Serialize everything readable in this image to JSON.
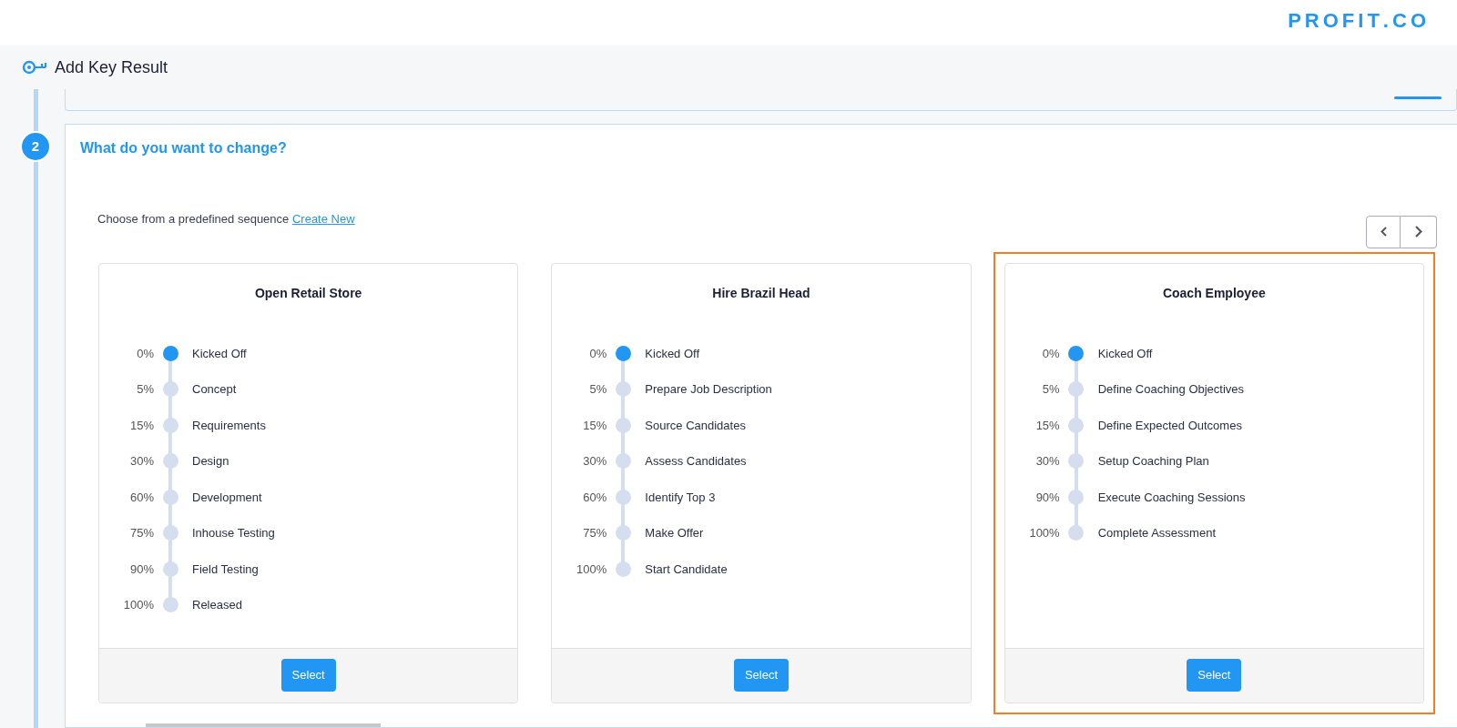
{
  "brand": {
    "logo": "PROFIT.CO"
  },
  "page": {
    "title": "Add Key Result"
  },
  "step": {
    "number": "2",
    "title": "What do you want to change?"
  },
  "intro": {
    "text": "Choose from a predefined sequence",
    "link": "Create New"
  },
  "cards": [
    {
      "title": "Open Retail Store",
      "highlighted": false,
      "button": "Select",
      "steps": [
        {
          "percent": "0%",
          "label": "Kicked Off",
          "active": true
        },
        {
          "percent": "5%",
          "label": "Concept",
          "active": false
        },
        {
          "percent": "15%",
          "label": "Requirements",
          "active": false
        },
        {
          "percent": "30%",
          "label": "Design",
          "active": false
        },
        {
          "percent": "60%",
          "label": "Development",
          "active": false
        },
        {
          "percent": "75%",
          "label": "Inhouse Testing",
          "active": false
        },
        {
          "percent": "90%",
          "label": "Field Testing",
          "active": false
        },
        {
          "percent": "100%",
          "label": "Released",
          "active": false
        }
      ]
    },
    {
      "title": "Hire Brazil Head",
      "highlighted": false,
      "button": "Select",
      "steps": [
        {
          "percent": "0%",
          "label": "Kicked Off",
          "active": true
        },
        {
          "percent": "5%",
          "label": "Prepare Job Description",
          "active": false
        },
        {
          "percent": "15%",
          "label": "Source Candidates",
          "active": false
        },
        {
          "percent": "30%",
          "label": "Assess Candidates",
          "active": false
        },
        {
          "percent": "60%",
          "label": "Identify Top 3",
          "active": false
        },
        {
          "percent": "75%",
          "label": "Make Offer",
          "active": false
        },
        {
          "percent": "100%",
          "label": "Start Candidate",
          "active": false
        }
      ]
    },
    {
      "title": "Coach Employee",
      "highlighted": true,
      "button": "Select",
      "steps": [
        {
          "percent": "0%",
          "label": "Kicked Off",
          "active": true
        },
        {
          "percent": "5%",
          "label": "Define Coaching Objectives",
          "active": false
        },
        {
          "percent": "15%",
          "label": "Define Expected Outcomes",
          "active": false
        },
        {
          "percent": "30%",
          "label": "Setup Coaching Plan",
          "active": false
        },
        {
          "percent": "90%",
          "label": "Execute Coaching Sessions",
          "active": false
        },
        {
          "percent": "100%",
          "label": "Complete Assessment",
          "active": false
        }
      ]
    }
  ]
}
